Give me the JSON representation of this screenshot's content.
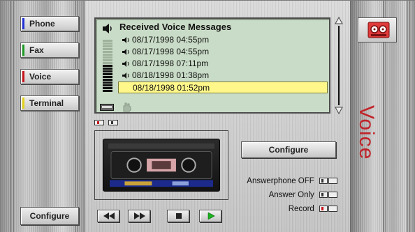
{
  "nav": {
    "items": [
      {
        "label": "Phone",
        "color": "#2231d4"
      },
      {
        "label": "Fax",
        "color": "#1c9b23"
      },
      {
        "label": "Voice",
        "color": "#c8141b"
      },
      {
        "label": "Terminal",
        "color": "#e3d21a"
      }
    ],
    "configure_label": "Configure"
  },
  "messages": {
    "title": "Received Voice Messages",
    "items": [
      {
        "label": "08/17/1998 04:55pm",
        "selected": false
      },
      {
        "label": "08/17/1998 04:55pm",
        "selected": false
      },
      {
        "label": "08/17/1998 07:11pm",
        "selected": false
      },
      {
        "label": "08/18/1998 01:38pm",
        "selected": false
      },
      {
        "label": "08/18/1998 01:52pm",
        "selected": true
      }
    ],
    "level_meter": {
      "filled_segments": 10,
      "total_segments": 19
    }
  },
  "panel": {
    "configure_label": "Configure",
    "options": [
      {
        "label": "Answerphone OFF",
        "state": "off"
      },
      {
        "label": "Answer Only",
        "state": "off"
      },
      {
        "label": "Record",
        "state": "on"
      }
    ]
  },
  "transport": {
    "buttons": [
      {
        "icon": "rewind-icon"
      },
      {
        "icon": "fast-forward-icon"
      },
      {
        "icon": "stop-icon"
      },
      {
        "icon": "play-icon"
      }
    ]
  },
  "right": {
    "section_label": "Voice",
    "icon": "tape-recorder-icon",
    "accent": "#c0242a"
  }
}
